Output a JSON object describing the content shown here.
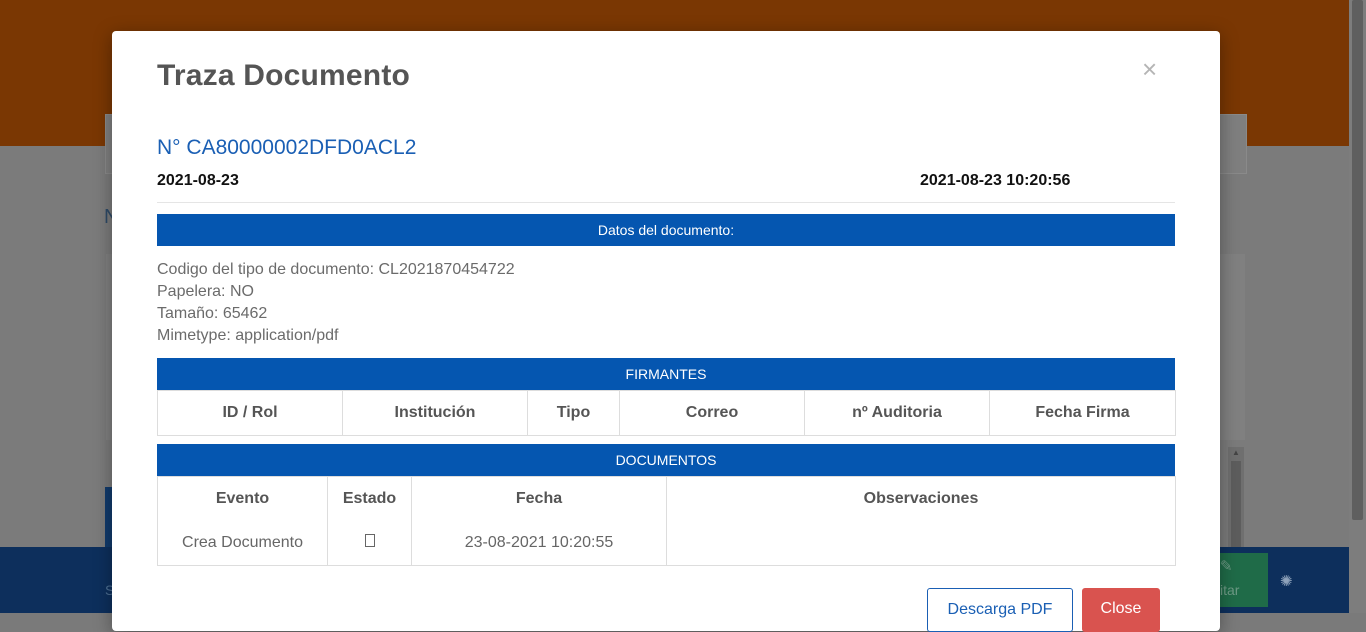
{
  "background": {
    "side_letter": "N",
    "footer_text": "S",
    "green_button_label": "itar"
  },
  "modal": {
    "title": "Traza Documento",
    "close_symbol": "×",
    "doc_number": "N° CA80000002DFD0ACL2",
    "date": "2021-08-23",
    "datetime": "2021-08-23 10:20:56",
    "datos_header": "Datos del documento:",
    "info": {
      "codigo": "Codigo del tipo de documento: CL2021870454722",
      "papelera": "Papelera: NO",
      "tamano": "Tamaño: 65462",
      "mimetype": "Mimetype: application/pdf"
    },
    "firmantes": {
      "header": "FIRMANTES",
      "columns": [
        "ID / Rol",
        "Institución",
        "Tipo",
        "Correo",
        "nº Auditoria",
        "Fecha Firma"
      ]
    },
    "documentos": {
      "header": "DOCUMENTOS",
      "columns": [
        "Evento",
        "Estado",
        "Fecha",
        "Observaciones"
      ],
      "rows": [
        {
          "evento": "Crea Documento",
          "estado": "",
          "fecha": "23-08-2021 10:20:55",
          "observaciones": ""
        }
      ]
    },
    "buttons": {
      "pdf": "Descarga PDF",
      "close": "Close"
    }
  },
  "colors": {
    "primary": "#0556b0",
    "link": "#1a5fb4",
    "danger": "#d9534f",
    "header_bg": "#7a3703"
  }
}
